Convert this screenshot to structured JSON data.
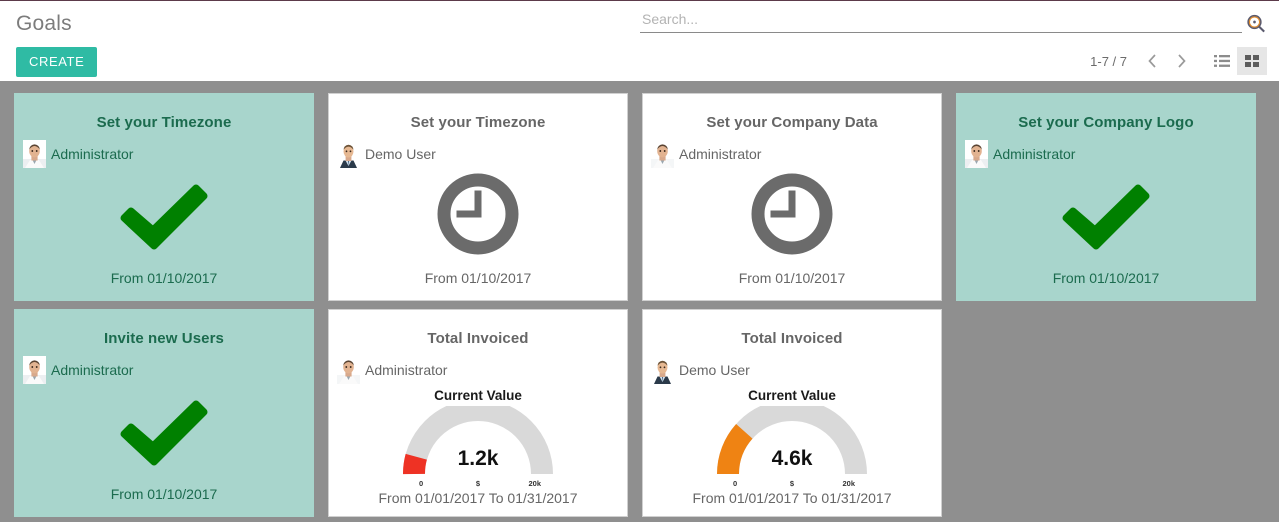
{
  "header": {
    "title": "Goals",
    "create_label": "CREATE",
    "search": {
      "value": "",
      "placeholder": "Search...",
      "icon": "search-plus-icon"
    },
    "pager": {
      "count_label": "1-7 / 7",
      "prev_icon": "chevron-left-icon",
      "next_icon": "chevron-right-icon"
    },
    "views": [
      {
        "name": "list-view",
        "icon": "list-icon",
        "active": false
      },
      {
        "name": "kanban-view",
        "icon": "grid-icon",
        "active": true
      }
    ]
  },
  "colors": {
    "accent": "#2fbba4",
    "done_card_bg": "#a8d5cc",
    "done_text": "#1b6b4e",
    "check_green": "#008000",
    "clock_gray": "#6b6b6b",
    "gauge_track": "#d9d9d9",
    "gauge_red": "#ee3224",
    "gauge_orange": "#ef8313",
    "page_bg": "#8f8f8f"
  },
  "cards": [
    {
      "title": "Set your Timezone",
      "user": "Administrator",
      "avatar": "admin-avatar",
      "state": "done",
      "visual": "check-icon",
      "period": "From 01/10/2017"
    },
    {
      "title": "Set your Timezone",
      "user": "Demo User",
      "avatar": "demo-avatar",
      "state": "pending",
      "visual": "clock-icon",
      "period": "From 01/10/2017"
    },
    {
      "title": "Set your Company Data",
      "user": "Administrator",
      "avatar": "admin-avatar",
      "state": "pending",
      "visual": "clock-icon",
      "period": "From 01/10/2017"
    },
    {
      "title": "Set your Company Logo",
      "user": "Administrator",
      "avatar": "admin-avatar",
      "state": "done",
      "visual": "check-icon",
      "period": "From 01/10/2017"
    },
    {
      "title": "Invite new Users",
      "user": "Administrator",
      "avatar": "admin-avatar",
      "state": "done",
      "visual": "check-icon",
      "period": "From 01/10/2017"
    },
    {
      "title": "Total Invoiced",
      "user": "Administrator",
      "avatar": "admin-avatar",
      "state": "gauge",
      "visual": "gauge-chart",
      "gauge_label": "Current Value",
      "gauge_value_label": "1.2k",
      "gauge_min_label": "0",
      "gauge_unit_label": "$",
      "gauge_max_label": "20k",
      "period": "From 01/01/2017 To 01/31/2017"
    },
    {
      "title": "Total Invoiced",
      "user": "Demo User",
      "avatar": "demo-avatar",
      "state": "gauge",
      "visual": "gauge-chart",
      "gauge_label": "Current Value",
      "gauge_value_label": "4.6k",
      "gauge_min_label": "0",
      "gauge_unit_label": "$",
      "gauge_max_label": "20k",
      "period": "From 01/01/2017 To 01/31/2017"
    }
  ],
  "chart_data": [
    {
      "type": "gauge",
      "title": "Current Value",
      "card": "Total Invoiced - Administrator",
      "value": 1200,
      "value_label": "1.2k",
      "min": 0,
      "max": 20000,
      "min_label": "0",
      "max_label": "20k",
      "unit": "$",
      "fill_color": "#ee3224",
      "track_color": "#d9d9d9",
      "fraction": 0.06
    },
    {
      "type": "gauge",
      "title": "Current Value",
      "card": "Total Invoiced - Demo User",
      "value": 4600,
      "value_label": "4.6k",
      "min": 0,
      "max": 20000,
      "min_label": "0",
      "max_label": "20k",
      "unit": "$",
      "fill_color": "#ef8313",
      "track_color": "#d9d9d9",
      "fraction": 0.23
    }
  ]
}
